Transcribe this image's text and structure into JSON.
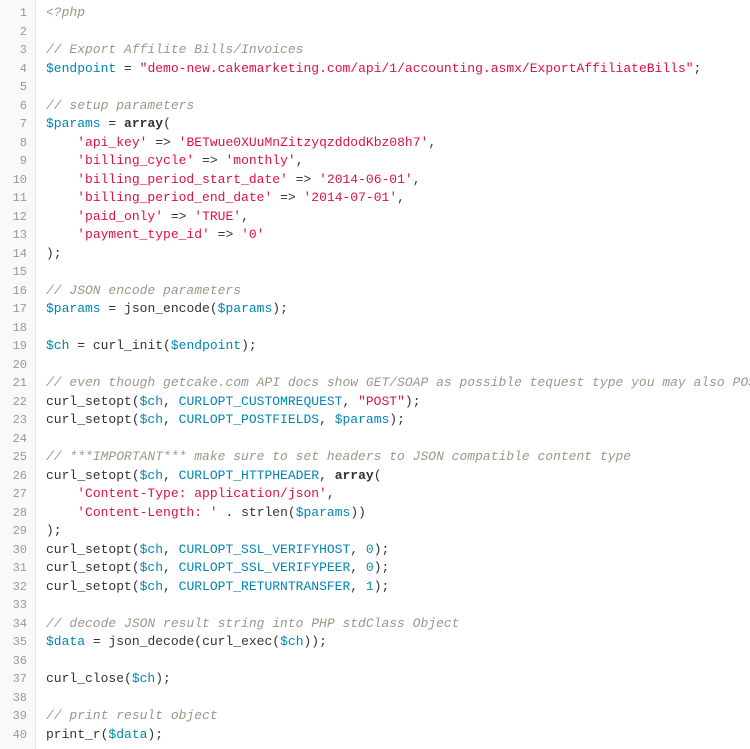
{
  "lines": [
    {
      "num": "1",
      "tokens": [
        {
          "cls": "k-php",
          "text": "<?php"
        }
      ]
    },
    {
      "num": "2",
      "tokens": []
    },
    {
      "num": "3",
      "tokens": [
        {
          "cls": "k-comment",
          "text": "// Export Affilite Bills/Invoices"
        }
      ]
    },
    {
      "num": "4",
      "tokens": [
        {
          "cls": "k-var",
          "text": "$endpoint"
        },
        {
          "cls": "k-punc",
          "text": " "
        },
        {
          "cls": "k-op",
          "text": "="
        },
        {
          "cls": "k-punc",
          "text": " "
        },
        {
          "cls": "k-str",
          "text": "\"demo-new.cakemarketing.com/api/1/accounting.asmx/ExportAffiliateBills\""
        },
        {
          "cls": "k-punc",
          "text": ";"
        }
      ]
    },
    {
      "num": "5",
      "tokens": []
    },
    {
      "num": "6",
      "tokens": [
        {
          "cls": "k-comment",
          "text": "// setup parameters"
        }
      ]
    },
    {
      "num": "7",
      "tokens": [
        {
          "cls": "k-var",
          "text": "$params"
        },
        {
          "cls": "k-punc",
          "text": " "
        },
        {
          "cls": "k-op",
          "text": "="
        },
        {
          "cls": "k-punc",
          "text": " "
        },
        {
          "cls": "k-kw",
          "text": "array"
        },
        {
          "cls": "k-punc",
          "text": "("
        }
      ]
    },
    {
      "num": "8",
      "tokens": [
        {
          "cls": "k-punc",
          "text": "    "
        },
        {
          "cls": "k-str",
          "text": "'api_key'"
        },
        {
          "cls": "k-punc",
          "text": " "
        },
        {
          "cls": "k-op",
          "text": "=>"
        },
        {
          "cls": "k-punc",
          "text": " "
        },
        {
          "cls": "k-str",
          "text": "'BETwue0XUuMnZitzyqzddodKbz08h7'"
        },
        {
          "cls": "k-punc",
          "text": ","
        }
      ]
    },
    {
      "num": "9",
      "tokens": [
        {
          "cls": "k-punc",
          "text": "    "
        },
        {
          "cls": "k-str",
          "text": "'billing_cycle'"
        },
        {
          "cls": "k-punc",
          "text": " "
        },
        {
          "cls": "k-op",
          "text": "=>"
        },
        {
          "cls": "k-punc",
          "text": " "
        },
        {
          "cls": "k-str",
          "text": "'monthly'"
        },
        {
          "cls": "k-punc",
          "text": ","
        }
      ]
    },
    {
      "num": "10",
      "tokens": [
        {
          "cls": "k-punc",
          "text": "    "
        },
        {
          "cls": "k-str",
          "text": "'billing_period_start_date'"
        },
        {
          "cls": "k-punc",
          "text": " "
        },
        {
          "cls": "k-op",
          "text": "=>"
        },
        {
          "cls": "k-punc",
          "text": " "
        },
        {
          "cls": "k-str",
          "text": "'2014-06-01'"
        },
        {
          "cls": "k-punc",
          "text": ","
        }
      ]
    },
    {
      "num": "11",
      "tokens": [
        {
          "cls": "k-punc",
          "text": "    "
        },
        {
          "cls": "k-str",
          "text": "'billing_period_end_date'"
        },
        {
          "cls": "k-punc",
          "text": " "
        },
        {
          "cls": "k-op",
          "text": "=>"
        },
        {
          "cls": "k-punc",
          "text": " "
        },
        {
          "cls": "k-str",
          "text": "'2014-07-01'"
        },
        {
          "cls": "k-punc",
          "text": ","
        }
      ]
    },
    {
      "num": "12",
      "tokens": [
        {
          "cls": "k-punc",
          "text": "    "
        },
        {
          "cls": "k-str",
          "text": "'paid_only'"
        },
        {
          "cls": "k-punc",
          "text": " "
        },
        {
          "cls": "k-op",
          "text": "=>"
        },
        {
          "cls": "k-punc",
          "text": " "
        },
        {
          "cls": "k-str",
          "text": "'TRUE'"
        },
        {
          "cls": "k-punc",
          "text": ","
        }
      ]
    },
    {
      "num": "13",
      "tokens": [
        {
          "cls": "k-punc",
          "text": "    "
        },
        {
          "cls": "k-str",
          "text": "'payment_type_id'"
        },
        {
          "cls": "k-punc",
          "text": " "
        },
        {
          "cls": "k-op",
          "text": "=>"
        },
        {
          "cls": "k-punc",
          "text": " "
        },
        {
          "cls": "k-str",
          "text": "'0'"
        }
      ]
    },
    {
      "num": "14",
      "tokens": [
        {
          "cls": "k-punc",
          "text": ");"
        }
      ]
    },
    {
      "num": "15",
      "tokens": []
    },
    {
      "num": "16",
      "tokens": [
        {
          "cls": "k-comment",
          "text": "// JSON encode parameters"
        }
      ]
    },
    {
      "num": "17",
      "tokens": [
        {
          "cls": "k-var",
          "text": "$params"
        },
        {
          "cls": "k-punc",
          "text": " "
        },
        {
          "cls": "k-op",
          "text": "="
        },
        {
          "cls": "k-punc",
          "text": " "
        },
        {
          "cls": "k-func",
          "text": "json_encode("
        },
        {
          "cls": "k-var",
          "text": "$params"
        },
        {
          "cls": "k-punc",
          "text": ");"
        }
      ]
    },
    {
      "num": "18",
      "tokens": []
    },
    {
      "num": "19",
      "tokens": [
        {
          "cls": "k-var",
          "text": "$ch"
        },
        {
          "cls": "k-punc",
          "text": " "
        },
        {
          "cls": "k-op",
          "text": "="
        },
        {
          "cls": "k-punc",
          "text": " "
        },
        {
          "cls": "k-func",
          "text": "curl_init("
        },
        {
          "cls": "k-var",
          "text": "$endpoint"
        },
        {
          "cls": "k-punc",
          "text": ");"
        }
      ]
    },
    {
      "num": "20",
      "tokens": []
    },
    {
      "num": "21",
      "tokens": [
        {
          "cls": "k-comment",
          "text": "// even though getcake.com API docs show GET/SOAP as possible tequest type you may also POST"
        }
      ]
    },
    {
      "num": "22",
      "tokens": [
        {
          "cls": "k-func",
          "text": "curl_setopt("
        },
        {
          "cls": "k-var",
          "text": "$ch"
        },
        {
          "cls": "k-punc",
          "text": ", "
        },
        {
          "cls": "k-const",
          "text": "CURLOPT_CUSTOMREQUEST"
        },
        {
          "cls": "k-punc",
          "text": ", "
        },
        {
          "cls": "k-str",
          "text": "\"POST\""
        },
        {
          "cls": "k-punc",
          "text": ");"
        }
      ]
    },
    {
      "num": "23",
      "tokens": [
        {
          "cls": "k-func",
          "text": "curl_setopt("
        },
        {
          "cls": "k-var",
          "text": "$ch"
        },
        {
          "cls": "k-punc",
          "text": ", "
        },
        {
          "cls": "k-const",
          "text": "CURLOPT_POSTFIELDS"
        },
        {
          "cls": "k-punc",
          "text": ", "
        },
        {
          "cls": "k-var",
          "text": "$params"
        },
        {
          "cls": "k-punc",
          "text": ");"
        }
      ]
    },
    {
      "num": "24",
      "tokens": []
    },
    {
      "num": "25",
      "tokens": [
        {
          "cls": "k-comment",
          "text": "// ***IMPORTANT*** make sure to set headers to JSON compatible content type"
        }
      ]
    },
    {
      "num": "26",
      "tokens": [
        {
          "cls": "k-func",
          "text": "curl_setopt("
        },
        {
          "cls": "k-var",
          "text": "$ch"
        },
        {
          "cls": "k-punc",
          "text": ", "
        },
        {
          "cls": "k-const",
          "text": "CURLOPT_HTTPHEADER"
        },
        {
          "cls": "k-punc",
          "text": ", "
        },
        {
          "cls": "k-kw",
          "text": "array"
        },
        {
          "cls": "k-punc",
          "text": "("
        }
      ]
    },
    {
      "num": "27",
      "tokens": [
        {
          "cls": "k-punc",
          "text": "    "
        },
        {
          "cls": "k-str",
          "text": "'Content-Type: application/json'"
        },
        {
          "cls": "k-punc",
          "text": ","
        }
      ]
    },
    {
      "num": "28",
      "tokens": [
        {
          "cls": "k-punc",
          "text": "    "
        },
        {
          "cls": "k-str",
          "text": "'Content-Length: '"
        },
        {
          "cls": "k-punc",
          "text": " "
        },
        {
          "cls": "k-op",
          "text": "."
        },
        {
          "cls": "k-punc",
          "text": " "
        },
        {
          "cls": "k-func",
          "text": "strlen("
        },
        {
          "cls": "k-var",
          "text": "$params"
        },
        {
          "cls": "k-punc",
          "text": "))"
        }
      ]
    },
    {
      "num": "29",
      "tokens": [
        {
          "cls": "k-punc",
          "text": ");"
        }
      ]
    },
    {
      "num": "30",
      "tokens": [
        {
          "cls": "k-func",
          "text": "curl_setopt("
        },
        {
          "cls": "k-var",
          "text": "$ch"
        },
        {
          "cls": "k-punc",
          "text": ", "
        },
        {
          "cls": "k-const",
          "text": "CURLOPT_SSL_VERIFYHOST"
        },
        {
          "cls": "k-punc",
          "text": ", "
        },
        {
          "cls": "k-num",
          "text": "0"
        },
        {
          "cls": "k-punc",
          "text": ");"
        }
      ]
    },
    {
      "num": "31",
      "tokens": [
        {
          "cls": "k-func",
          "text": "curl_setopt("
        },
        {
          "cls": "k-var",
          "text": "$ch"
        },
        {
          "cls": "k-punc",
          "text": ", "
        },
        {
          "cls": "k-const",
          "text": "CURLOPT_SSL_VERIFYPEER"
        },
        {
          "cls": "k-punc",
          "text": ", "
        },
        {
          "cls": "k-num",
          "text": "0"
        },
        {
          "cls": "k-punc",
          "text": ");"
        }
      ]
    },
    {
      "num": "32",
      "tokens": [
        {
          "cls": "k-func",
          "text": "curl_setopt("
        },
        {
          "cls": "k-var",
          "text": "$ch"
        },
        {
          "cls": "k-punc",
          "text": ", "
        },
        {
          "cls": "k-const",
          "text": "CURLOPT_RETURNTRANSFER"
        },
        {
          "cls": "k-punc",
          "text": ", "
        },
        {
          "cls": "k-num",
          "text": "1"
        },
        {
          "cls": "k-punc",
          "text": ");"
        }
      ]
    },
    {
      "num": "33",
      "tokens": []
    },
    {
      "num": "34",
      "tokens": [
        {
          "cls": "k-comment",
          "text": "// decode JSON result string into PHP stdClass Object"
        }
      ]
    },
    {
      "num": "35",
      "tokens": [
        {
          "cls": "k-var",
          "text": "$data"
        },
        {
          "cls": "k-punc",
          "text": " "
        },
        {
          "cls": "k-op",
          "text": "="
        },
        {
          "cls": "k-punc",
          "text": " "
        },
        {
          "cls": "k-func",
          "text": "json_decode(curl_exec("
        },
        {
          "cls": "k-var",
          "text": "$ch"
        },
        {
          "cls": "k-punc",
          "text": "));"
        }
      ]
    },
    {
      "num": "36",
      "tokens": []
    },
    {
      "num": "37",
      "tokens": [
        {
          "cls": "k-func",
          "text": "curl_close("
        },
        {
          "cls": "k-var",
          "text": "$ch"
        },
        {
          "cls": "k-punc",
          "text": ");"
        }
      ]
    },
    {
      "num": "38",
      "tokens": []
    },
    {
      "num": "39",
      "tokens": [
        {
          "cls": "k-comment",
          "text": "// print result object"
        }
      ]
    },
    {
      "num": "40",
      "tokens": [
        {
          "cls": "k-func",
          "text": "print_r("
        },
        {
          "cls": "k-var",
          "text": "$data"
        },
        {
          "cls": "k-punc",
          "text": ");"
        }
      ]
    }
  ]
}
